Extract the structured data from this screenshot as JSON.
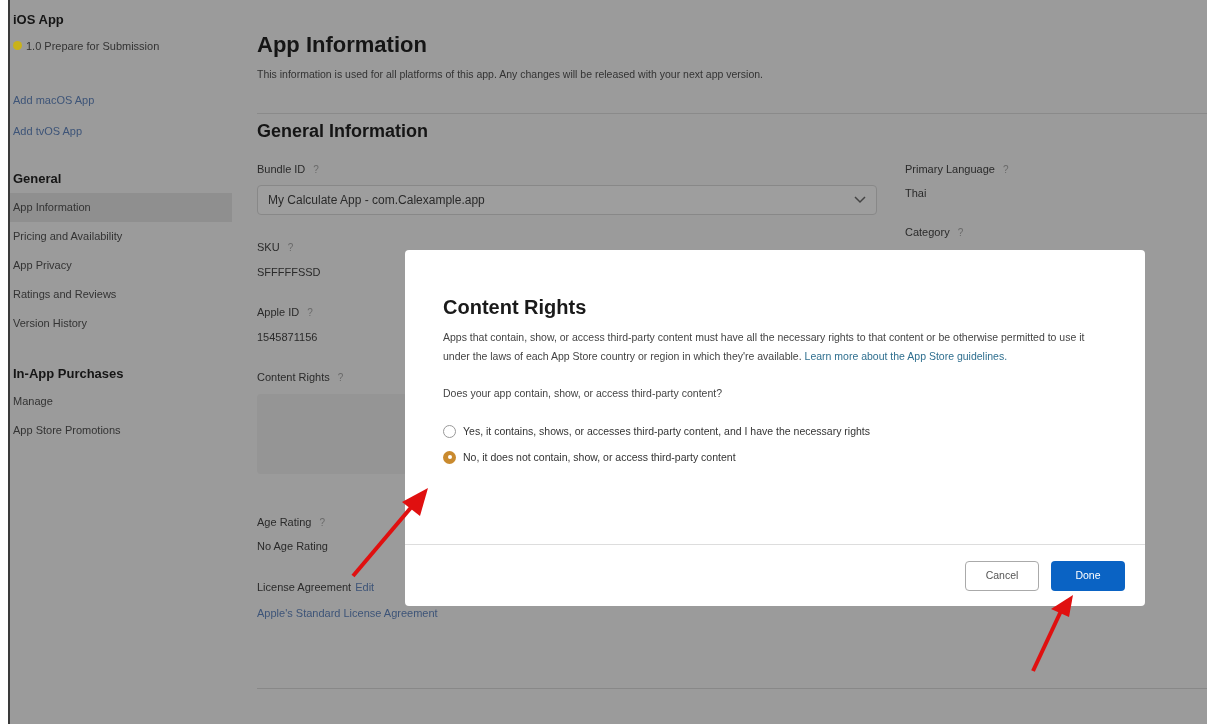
{
  "sidebar": {
    "app_title": "iOS App",
    "version": {
      "label": "1.0 Prepare for Submission",
      "color": "#c9b21a"
    },
    "links": [
      "Add macOS App",
      "Add tvOS App"
    ],
    "sections": [
      {
        "heading": "General",
        "items": [
          {
            "label": "App Information",
            "selected": true
          },
          {
            "label": "Pricing and Availability",
            "selected": false
          },
          {
            "label": "App Privacy",
            "selected": false
          },
          {
            "label": "Ratings and Reviews",
            "selected": false
          },
          {
            "label": "Version History",
            "selected": false
          }
        ]
      },
      {
        "heading": "In-App Purchases",
        "items": [
          {
            "label": "Manage",
            "selected": false
          },
          {
            "label": "App Store Promotions",
            "selected": false
          }
        ]
      }
    ]
  },
  "main": {
    "title": "App Information",
    "subtitle": "This information is used for all platforms of this app. Any changes will be released with your next app version.",
    "section_title": "General Information",
    "help_mark": "?",
    "bundle_id": {
      "label": "Bundle ID",
      "value": "My Calculate App - com.Calexample.app"
    },
    "sku": {
      "label": "SKU",
      "value": "SFFFFFSSD"
    },
    "apple_id": {
      "label": "Apple ID",
      "value": "1545871156"
    },
    "content_rights": {
      "label": "Content Rights"
    },
    "age_rating": {
      "label": "Age Rating",
      "value": "No Age Rating"
    },
    "license": {
      "label": "License Agreement",
      "edit": "Edit",
      "link": "Apple's Standard License Agreement"
    },
    "primary_language": {
      "label": "Primary Language",
      "value": "Thai"
    },
    "category": {
      "label": "Category"
    }
  },
  "dialog": {
    "title": "Content Rights",
    "body": "Apps that contain, show, or access third-party content must have all the necessary rights to that content or be otherwise permitted to use it under the laws of each App Store country or region in which they're available.",
    "body_link": "Learn more about the App Store guidelines.",
    "question": "Does your app contain, show, or access third-party content?",
    "options": [
      {
        "label": "Yes, it contains, shows, or accesses third-party content, and I have the necessary rights",
        "selected": false
      },
      {
        "label": "No, it does not contain, show, or access third-party content",
        "selected": true
      }
    ],
    "buttons": [
      {
        "label": "Cancel",
        "kind": "secondary"
      },
      {
        "label": "Done",
        "kind": "primary"
      }
    ]
  }
}
